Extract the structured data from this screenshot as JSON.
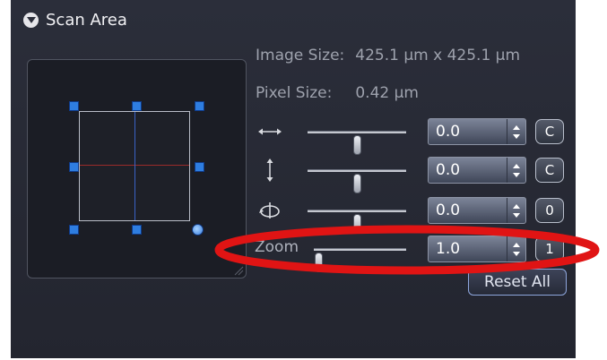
{
  "header": {
    "title": "Scan Area",
    "icon": "collapse-icon"
  },
  "info": {
    "image_size_label": "Image Size:",
    "image_size_value": "425.1  µm x 425.1  µm",
    "pixel_size_label": "Pixel Size:",
    "pixel_size_value": "0.42 µm"
  },
  "controls": {
    "offset_x": {
      "icon": "horizontal-arrows-icon",
      "value": "0.0",
      "button": "C",
      "slider_position": 0.5
    },
    "offset_y": {
      "icon": "vertical-arrows-icon",
      "value": "0.0",
      "button": "C",
      "slider_position": 0.5
    },
    "rotation": {
      "icon": "rotation-icon",
      "value": "0.0",
      "button": "0",
      "slider_position": 0.5
    },
    "zoom": {
      "label": "Zoom",
      "value": "1.0",
      "button": "1",
      "slider_position": 0.05
    }
  },
  "reset_button": "Reset All",
  "colors": {
    "panel": "#2b2e3a",
    "handle": "#2e7de0",
    "crosshair_h": "#9a2a2a",
    "crosshair_v": "#3a62c6",
    "highlight": "#e01414"
  }
}
